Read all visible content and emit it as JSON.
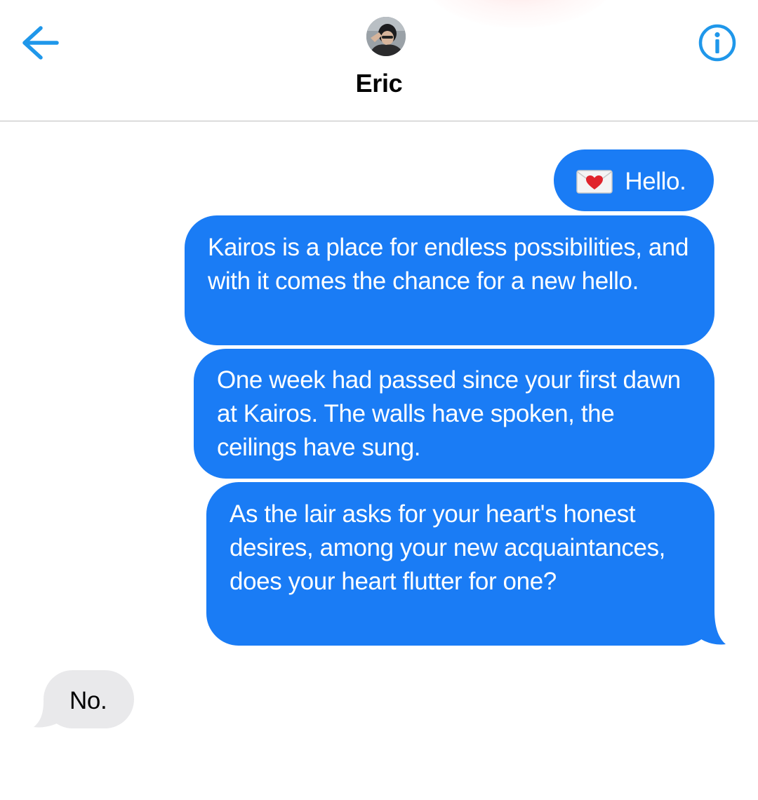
{
  "header": {
    "contact_name": "Eric",
    "back_icon": "arrow-left-icon",
    "info_icon": "info-circle-icon",
    "accent_color": "#1f97ea"
  },
  "messages": [
    {
      "direction": "outgoing",
      "emoji": "love-letter-emoji",
      "text": "Hello."
    },
    {
      "direction": "outgoing",
      "text": "Kairos is a place for endless possibilities, and with it comes the chance for a new hello."
    },
    {
      "direction": "outgoing",
      "text": "One week had passed since your first dawn at Kairos. The walls have spoken, the ceilings have sung."
    },
    {
      "direction": "outgoing",
      "text": "As the lair asks for your heart's honest desires, among your new acquaintances, does your heart flutter for one?"
    },
    {
      "direction": "incoming",
      "text": "No."
    }
  ],
  "colors": {
    "outgoing_bubble": "#1a7cf5",
    "incoming_bubble": "#e9e9eb"
  }
}
